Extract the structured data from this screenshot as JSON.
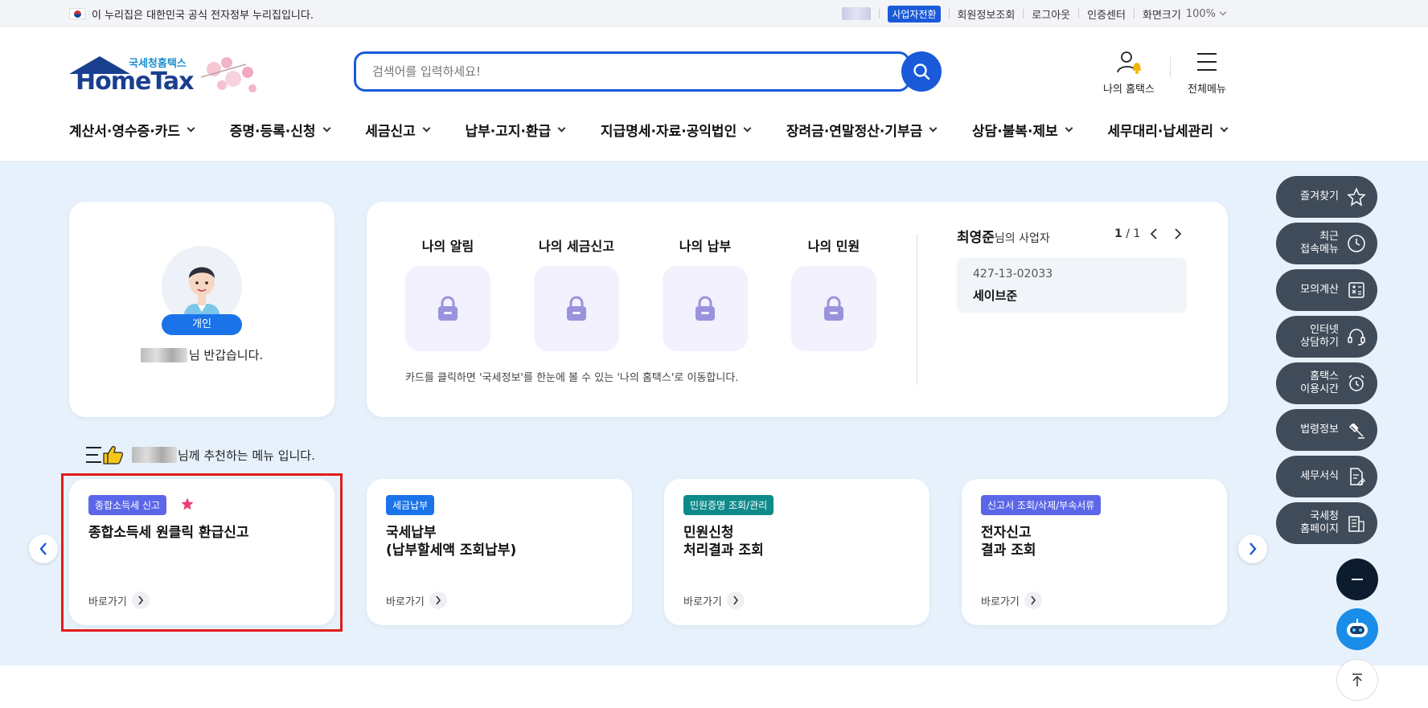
{
  "gov_bar": {
    "notice": "이 누리집은 대한민국 공식 전자정부 누리집입니다.",
    "biz_switch": "사업자전환",
    "member_info": "회원정보조회",
    "logout": "로그아웃",
    "cert_center": "인증센터",
    "screen_size_label": "화면크기",
    "screen_size_value": "100%"
  },
  "header": {
    "logo_sub": "국세청홈택스",
    "logo_main": "HomeTax",
    "search_placeholder": "검색어를 입력하세요!",
    "my_hometax": "나의 홈택스",
    "all_menu": "전체메뉴"
  },
  "nav": {
    "items": [
      "계산서·영수증·카드",
      "증명·등록·신청",
      "세금신고",
      "납부·고지·환급",
      "지급명세·자료·공익법인",
      "장려금·연말정산·기부금",
      "상담·불복·제보",
      "세무대리·납세관리"
    ]
  },
  "profile": {
    "tag": "개인",
    "greeting_suffix": "님 반갑습니다."
  },
  "info": {
    "cols": [
      "나의 알림",
      "나의 세금신고",
      "나의 납부",
      "나의 민원"
    ],
    "note": "카드를 클릭하면 '국세정보'를 한눈에 볼 수 있는 '나의 홈택스'로 이동합니다.",
    "owner_name": "최영준",
    "owner_suffix": "님의 사업자",
    "pager_current": "1",
    "pager_total": "/ 1",
    "biz_number": "427-13-02033",
    "biz_name": "세이브준"
  },
  "recommend": {
    "title_suffix": "님께 추천하는 메뉴 입니다.",
    "go_label": "바로가기",
    "cards": [
      {
        "badge": "종합소득세 신고",
        "line1": "종합소득세 원클릭 환급신고",
        "line2": "",
        "badge_color": "#5b67e8"
      },
      {
        "badge": "세금납부",
        "line1": "국세납부",
        "line2": "(납부할세액 조회납부)",
        "badge_color": "#1a73e8"
      },
      {
        "badge": "민원증명 조회/관리",
        "line1": "민원신청",
        "line2": "처리결과 조회",
        "badge_color": "#0f8a8a"
      },
      {
        "badge": "신고서 조회/삭제/부속서류",
        "line1": "전자신고",
        "line2": "결과 조회",
        "badge_color": "#5b67e8"
      }
    ]
  },
  "quick_menu": {
    "favorites": "즐겨찾기",
    "recent_1": "최근",
    "recent_2": "접속메뉴",
    "simulate": "모의계산",
    "counsel_1": "인터넷",
    "counsel_2": "상담하기",
    "hours_1": "홈택스",
    "hours_2": "이용시간",
    "law": "법령정보",
    "forms": "세무서식",
    "nts_1": "국세청",
    "nts_2": "홈페이지"
  }
}
